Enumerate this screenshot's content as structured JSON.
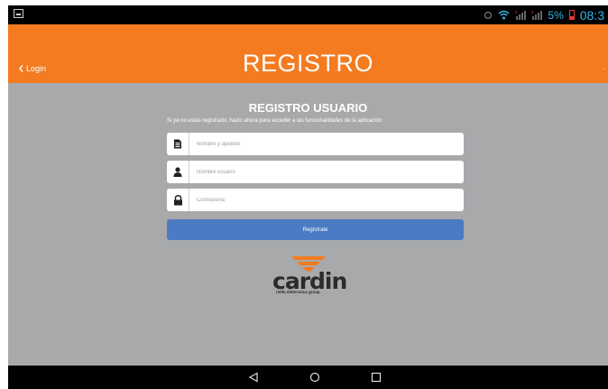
{
  "status": {
    "battery_text": "5%",
    "time": "08:3"
  },
  "header": {
    "back_label": "Login",
    "title": "REGISTRO"
  },
  "form": {
    "title": "REGISTRO USUARIO",
    "subtitle": "Si ya no estás registrado, hazlo ahora para acceder a las funcionalidades de la aplicación",
    "fields": [
      {
        "icon": "document-icon",
        "placeholder": "Nombre y apellido",
        "value": ""
      },
      {
        "icon": "user-icon",
        "placeholder": "Nombre usuario",
        "value": ""
      },
      {
        "icon": "lock-icon",
        "placeholder": "Contraseña",
        "value": ""
      }
    ],
    "submit_label": "Regístrate"
  },
  "logo": {
    "word": "cardin",
    "tagline": "riello elettronica group"
  },
  "nav": {
    "buttons": [
      "back-icon",
      "home-icon",
      "recents-icon"
    ]
  },
  "colors": {
    "header": "#f47b20",
    "background": "#a8a9ab",
    "button": "#4b7bc2",
    "status_accent": "#33b5e5"
  }
}
